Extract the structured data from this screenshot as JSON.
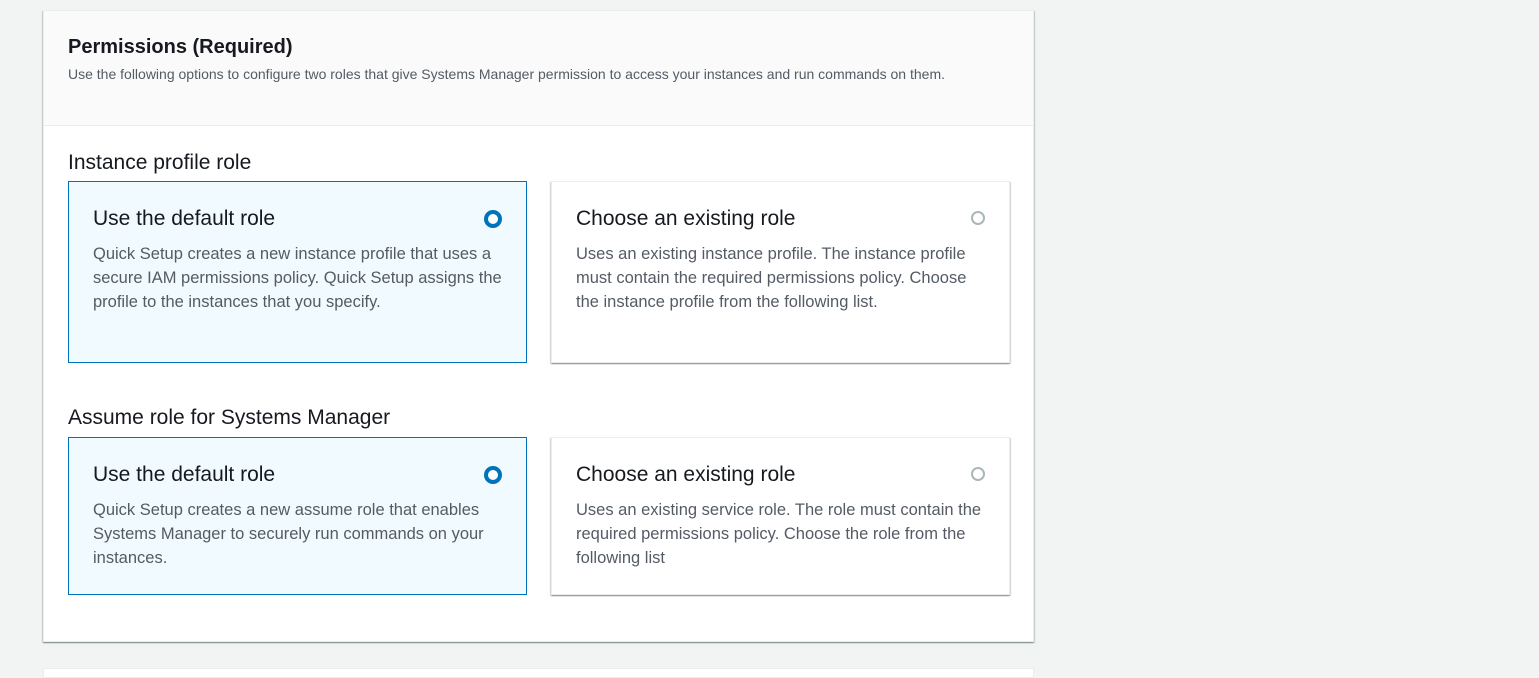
{
  "panel": {
    "title": "Permissions (Required)",
    "description": "Use the following options to configure two roles that give Systems Manager permission to access your instances and run commands on them."
  },
  "instance_profile": {
    "label": "Instance profile role",
    "default_option": {
      "title": "Use the default role",
      "description": "Quick Setup creates a new instance profile that uses a secure IAM permissions policy. Quick Setup assigns the profile to the instances that you specify.",
      "selected": true
    },
    "existing_option": {
      "title": "Choose an existing role",
      "description": "Uses an existing instance profile. The instance profile must contain the required permissions policy. Choose the instance profile from the following list.",
      "selected": false
    }
  },
  "assume_role": {
    "label": "Assume role for Systems Manager",
    "default_option": {
      "title": "Use the default role",
      "description": "Quick Setup creates a new assume role that enables Systems Manager to securely run commands on your instances.",
      "selected": true
    },
    "existing_option": {
      "title": "Choose an existing role",
      "description": "Uses an existing service role. The role must contain the required permissions policy. Choose the role from the following list",
      "selected": false
    }
  },
  "colors": {
    "accent": "#0073bb",
    "selected_bg": "#f1faff",
    "text": "#16191f",
    "muted_text": "#545b64",
    "page_bg": "#f2f3f3"
  }
}
